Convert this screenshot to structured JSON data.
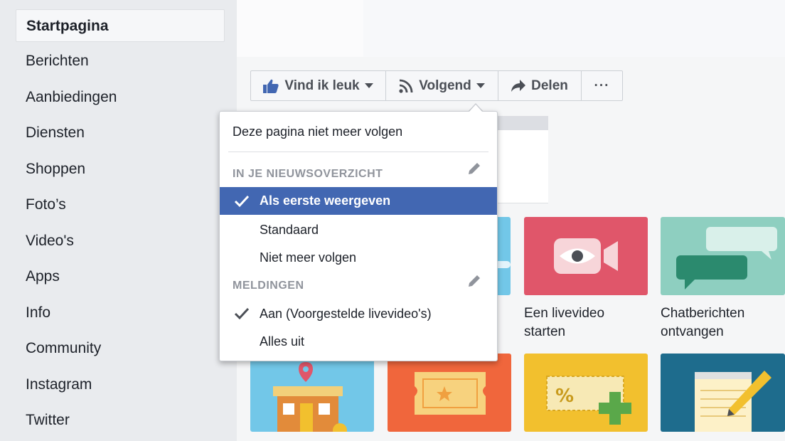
{
  "sidebar": {
    "items": [
      "Startpagina",
      "Berichten",
      "Aanbiedingen",
      "Diensten",
      "Shoppen",
      "Foto’s",
      "Video's",
      "Apps",
      "Info",
      "Community",
      "Instagram",
      "Twitter"
    ],
    "active": "Startpagina"
  },
  "action_bar": {
    "like_label": "Vind ik leuk",
    "follow_label": "Volgend",
    "share_label": "Delen",
    "more_label": "···"
  },
  "dropdown": {
    "unfollow_page": "Deze pagina niet meer volgen",
    "news_feed_header": "IN JE NIEUWSOVERZICHT",
    "feed_options": [
      {
        "label": "Als eerste weergeven",
        "selected": true
      },
      {
        "label": "Standaard",
        "selected": false
      },
      {
        "label": "Niet meer volgen",
        "selected": false
      }
    ],
    "notifications_header": "MELDINGEN",
    "notification_options": [
      {
        "label": "Aan (Voorgestelde livevideo's)",
        "selected": true
      },
      {
        "label": "Alles uit",
        "selected": false
      }
    ]
  },
  "tiles": {
    "live_video_line1": "Een livevideo",
    "live_video_line2": "starten",
    "chat_line1": "Chatberichten",
    "chat_line2": "ontvangen"
  },
  "colors": {
    "accent": "#4267b2",
    "like_blue": "#4267b2",
    "tile_red": "#e0566a",
    "tile_teal": "#8ecfc0",
    "tile_blue_light": "#72c7e8",
    "tile_orange": "#f0663c",
    "tile_yellow": "#f2c02e",
    "tile_navy": "#1e6c8d"
  }
}
